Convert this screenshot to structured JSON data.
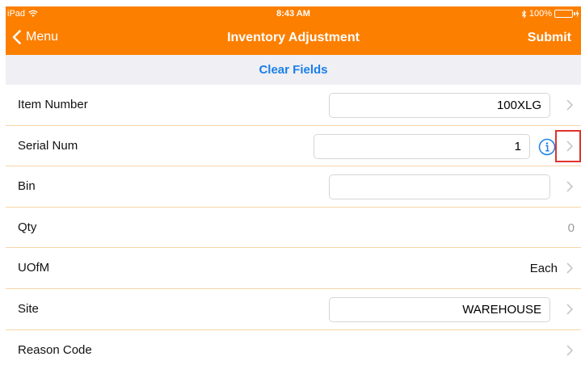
{
  "status_bar": {
    "device": "iPad",
    "time": "8:43 AM",
    "battery_percent": "100%",
    "battery_level": 1.0,
    "icons": [
      "wifi-icon",
      "bluetooth-icon",
      "battery-icon",
      "charging-icon"
    ]
  },
  "nav": {
    "back_label": "Menu",
    "title": "Inventory Adjustment",
    "submit_label": "Submit",
    "bar_color": "#fc7f00"
  },
  "toolbar": {
    "clear_label": "Clear Fields",
    "link_color": "#1a7fe8"
  },
  "form": {
    "rows": [
      {
        "label": "Item Number",
        "value": "100XLG"
      },
      {
        "label": "Serial Num",
        "value": "1"
      },
      {
        "label": "Bin",
        "value": ""
      },
      {
        "label": "Qty",
        "value": "0"
      },
      {
        "label": "UOfM",
        "value": "Each"
      },
      {
        "label": "Site",
        "value": "WAREHOUSE"
      },
      {
        "label": "Reason Code",
        "value": ""
      }
    ]
  },
  "colors": {
    "separator": "#f8d4a8",
    "highlight": "#e0332c"
  }
}
